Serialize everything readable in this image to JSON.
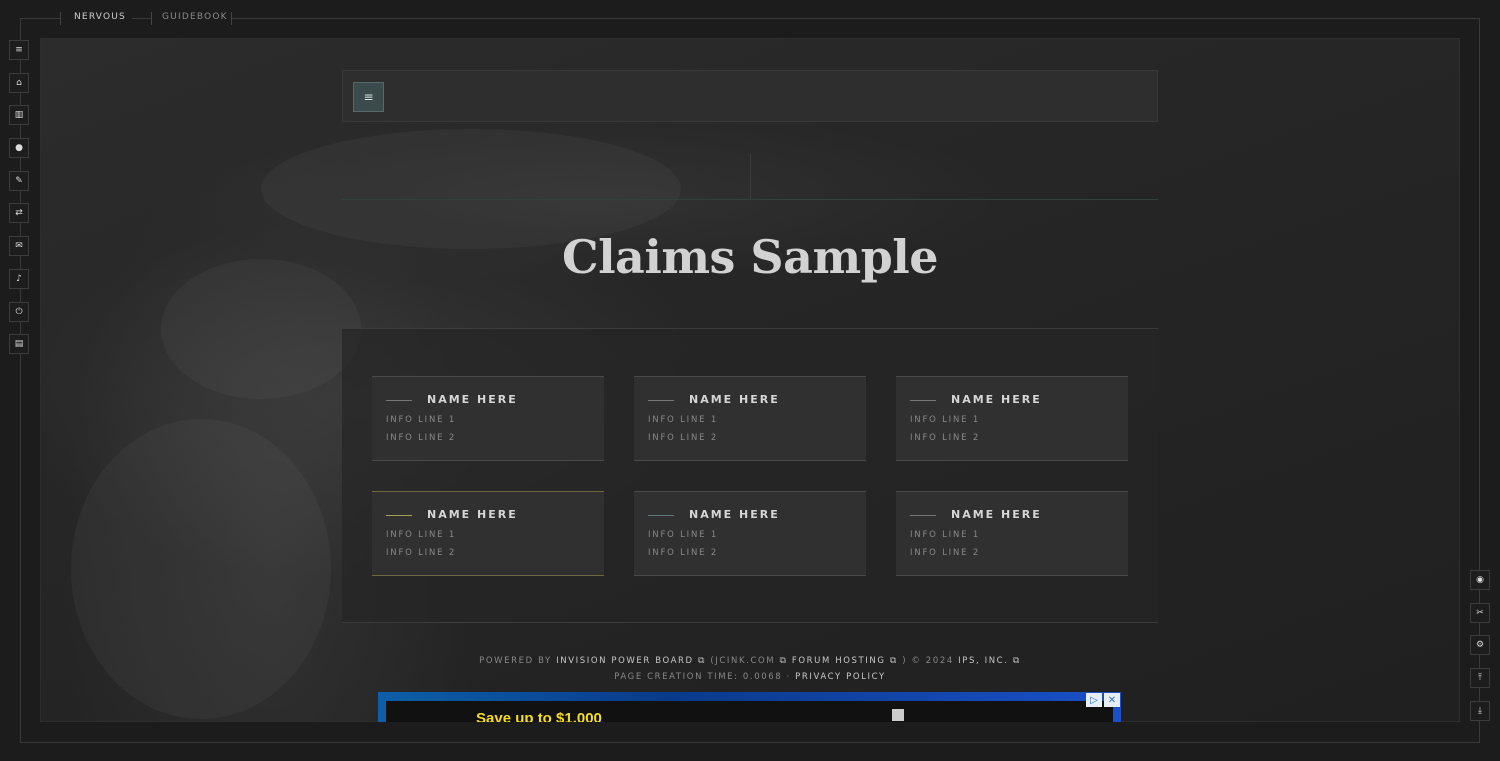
{
  "topnav": {
    "items": [
      "NERVOUS",
      "GUIDEBOOK"
    ]
  },
  "left_rail": {
    "icons": [
      {
        "name": "menu-icon",
        "glyph": "≡"
      },
      {
        "name": "home-icon",
        "glyph": "⌂"
      },
      {
        "name": "library-icon",
        "glyph": "▥"
      },
      {
        "name": "user-icon",
        "glyph": "●"
      },
      {
        "name": "pencil-icon",
        "glyph": "✎"
      },
      {
        "name": "exchange-icon",
        "glyph": "⇄"
      },
      {
        "name": "envelope-icon",
        "glyph": "✉"
      },
      {
        "name": "bell-icon",
        "glyph": "♪"
      },
      {
        "name": "power-icon",
        "glyph": "⏻"
      },
      {
        "name": "archive-icon",
        "glyph": "▤"
      }
    ]
  },
  "right_rail": {
    "icons": [
      {
        "name": "discord-icon",
        "glyph": "◉"
      },
      {
        "name": "tools-icon",
        "glyph": "✂"
      },
      {
        "name": "gear-icon",
        "glyph": "⚙"
      },
      {
        "name": "scroll-top-icon",
        "glyph": "⤒"
      },
      {
        "name": "download-icon",
        "glyph": "⤓"
      }
    ]
  },
  "topbar": {
    "menu_glyph": "≡"
  },
  "page": {
    "title": "Claims Sample"
  },
  "claims": [
    {
      "name": "NAME HERE",
      "info1": "INFO LINE 1",
      "info2": "INFO LINE 2",
      "accent": "#777777"
    },
    {
      "name": "NAME HERE",
      "info1": "INFO LINE 1",
      "info2": "INFO LINE 2",
      "accent": "#777777"
    },
    {
      "name": "NAME HERE",
      "info1": "INFO LINE 1",
      "info2": "INFO LINE 2",
      "accent": "#777777"
    },
    {
      "name": "NAME HERE",
      "info1": "INFO LINE 1",
      "info2": "INFO LINE 2",
      "accent": "#a6a052"
    },
    {
      "name": "NAME HERE",
      "info1": "INFO LINE 1",
      "info2": "INFO LINE 2",
      "accent": "#5d7a7b"
    },
    {
      "name": "NAME HERE",
      "info1": "INFO LINE 1",
      "info2": "INFO LINE 2",
      "accent": "#777777"
    }
  ],
  "footer": {
    "powered_by": "POWERED BY",
    "ipb_link": "INVISION POWER BOARD",
    "jcink_open": "(JCINK.COM",
    "hosting_link": "FORUM HOSTING",
    "copyright": ") © 2024",
    "ips_link": "IPS, INC.",
    "page_time": "PAGE CREATION TIME: 0.0068 ·",
    "privacy_link": "PRIVACY POLICY"
  },
  "ad": {
    "text": "Save up to $1,000"
  },
  "colors": {
    "accent_button": "#3b4a4b",
    "background": "#1c1c1c",
    "gold": "#a6a052",
    "teal": "#5d7a7b"
  }
}
